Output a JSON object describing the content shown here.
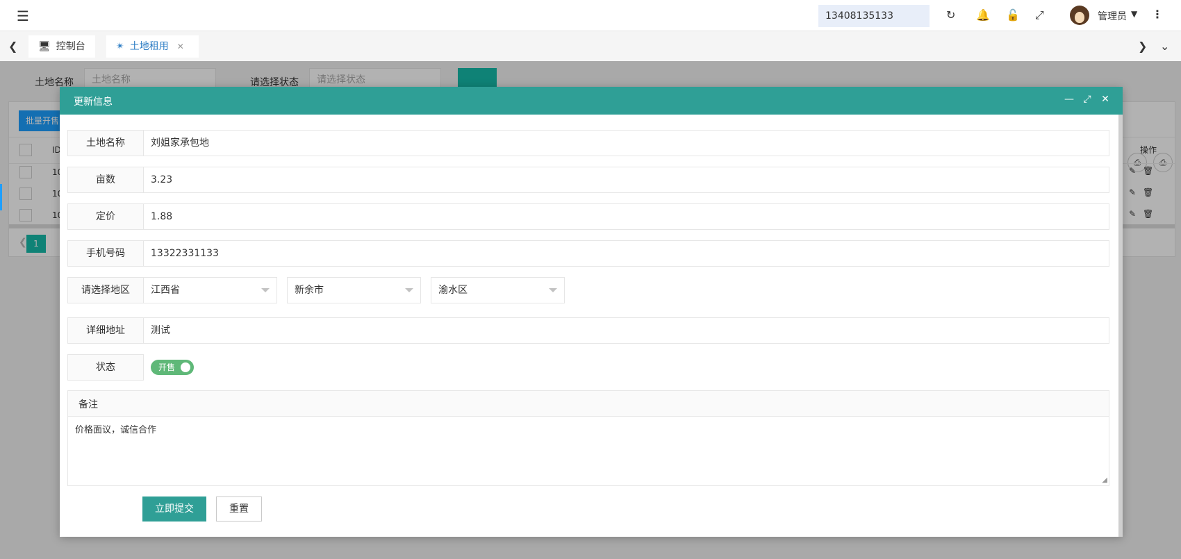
{
  "topbar": {
    "phone": "13408135133",
    "user_name": "管理员"
  },
  "tabs": {
    "console_label": "控制台",
    "land_label": "土地租用"
  },
  "search": {
    "land_name_label": "土地名称",
    "land_name_placeholder": "土地名称",
    "status_label": "请选择状态",
    "status_placeholder": "请选择状态"
  },
  "background_table": {
    "batch_button": "批量开售",
    "col_id": "ID",
    "col_actions": "操作",
    "row_ids": [
      "10",
      "10",
      "10"
    ],
    "page_current": "1"
  },
  "dialog": {
    "title": "更新信息",
    "fields": {
      "land_name": {
        "label": "土地名称",
        "value": "刘姐家承包地"
      },
      "acreage": {
        "label": "亩数",
        "value": "3.23"
      },
      "price": {
        "label": "定价",
        "value": "1.88"
      },
      "phone": {
        "label": "手机号码",
        "value": "13322331133"
      },
      "region": {
        "label": "请选择地区",
        "province": "江西省",
        "city": "新余市",
        "district": "渝水区"
      },
      "address": {
        "label": "详细地址",
        "value": "测试"
      },
      "status": {
        "label": "状态",
        "switch_text": "开售",
        "on": true
      }
    },
    "remark": {
      "label": "备注",
      "value": "价格面议，诚信合作"
    },
    "submit_label": "立即提交",
    "reset_label": "重置"
  },
  "colors": {
    "dialog_header": "#2f9f96",
    "switch_on": "#5fb878",
    "tab_active": "#2b7cc4"
  }
}
